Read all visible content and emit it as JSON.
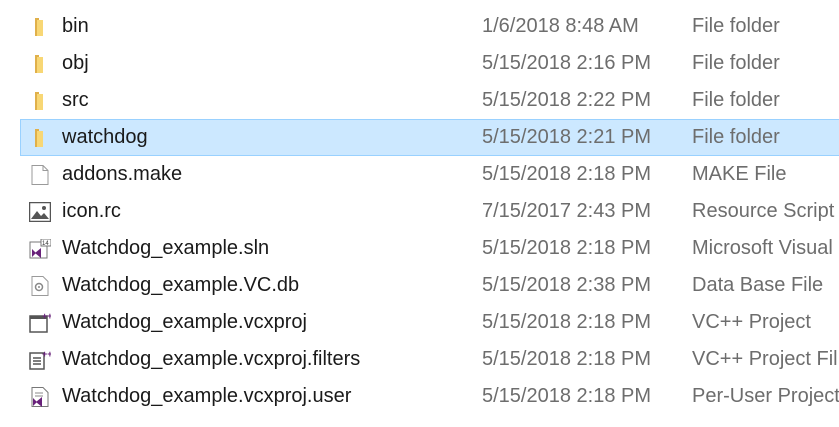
{
  "files": [
    {
      "name": "bin",
      "date": "1/6/2018 8:48 AM",
      "type": "File folder",
      "icon": "folder-icon",
      "selected": false
    },
    {
      "name": "obj",
      "date": "5/15/2018 2:16 PM",
      "type": "File folder",
      "icon": "folder-icon",
      "selected": false
    },
    {
      "name": "src",
      "date": "5/15/2018 2:22 PM",
      "type": "File folder",
      "icon": "folder-icon",
      "selected": false
    },
    {
      "name": "watchdog",
      "date": "5/15/2018 2:21 PM",
      "type": "File folder",
      "icon": "folder-icon",
      "selected": true
    },
    {
      "name": "addons.make",
      "date": "5/15/2018 2:18 PM",
      "type": "MAKE File",
      "icon": "blank-file-icon",
      "selected": false
    },
    {
      "name": "icon.rc",
      "date": "7/15/2017 2:43 PM",
      "type": "Resource Script",
      "icon": "image-file-icon",
      "selected": false
    },
    {
      "name": "Watchdog_example.sln",
      "date": "5/15/2018 2:18 PM",
      "type": "Microsoft Visual",
      "icon": "visual-studio-solution-icon",
      "selected": false
    },
    {
      "name": "Watchdog_example.VC.db",
      "date": "5/15/2018 2:38 PM",
      "type": "Data Base File",
      "icon": "database-file-icon",
      "selected": false
    },
    {
      "name": "Watchdog_example.vcxproj",
      "date": "5/15/2018 2:18 PM",
      "type": "VC++ Project",
      "icon": "vc-project-icon",
      "selected": false
    },
    {
      "name": "Watchdog_example.vcxproj.filters",
      "date": "5/15/2018 2:18 PM",
      "type": "VC++ Project Fil",
      "icon": "vc-project-filters-icon",
      "selected": false
    },
    {
      "name": "Watchdog_example.vcxproj.user",
      "date": "5/15/2018 2:18 PM",
      "type": "Per-User Project",
      "icon": "vc-project-user-icon",
      "selected": false
    }
  ],
  "colors": {
    "selection_bg": "#cce8ff",
    "selection_border": "#99d1ff",
    "folder": "#f8d775",
    "vs_purple": "#68217a"
  }
}
